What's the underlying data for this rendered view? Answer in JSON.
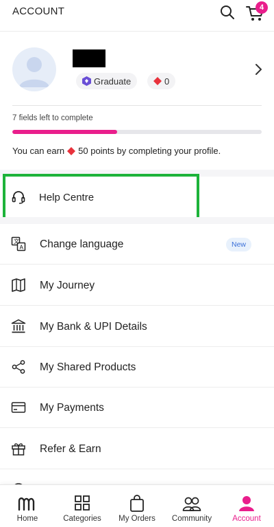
{
  "header": {
    "title": "ACCOUNT",
    "cart_count": "4"
  },
  "profile": {
    "badge_label": "Graduate",
    "points": "0",
    "fields_left": "7 fields left to complete",
    "progress_fraction": 0.42,
    "earn_prefix": "You can earn",
    "earn_suffix": "50 points by completing your profile."
  },
  "help": {
    "label": "Help Centre"
  },
  "menu": {
    "items": [
      {
        "label": "Change language",
        "icon": "translate-icon",
        "badge": "New"
      },
      {
        "label": "My Journey",
        "icon": "map-icon"
      },
      {
        "label": "My Bank & UPI Details",
        "icon": "bank-icon"
      },
      {
        "label": "My Shared Products",
        "icon": "share-icon"
      },
      {
        "label": "My Payments",
        "icon": "card-icon"
      },
      {
        "label": "Refer & Earn",
        "icon": "gift-icon"
      }
    ]
  },
  "bottom_nav": {
    "items": [
      {
        "label": "Home",
        "icon": "home-logo-icon"
      },
      {
        "label": "Categories",
        "icon": "grid-icon"
      },
      {
        "label": "My Orders",
        "icon": "bag-icon"
      },
      {
        "label": "Community",
        "icon": "people-icon"
      },
      {
        "label": "Account",
        "icon": "person-icon",
        "active": true
      }
    ]
  },
  "colors": {
    "accent": "#e91e8c",
    "highlight": "#1db33a",
    "gem": "#e8323c",
    "badge_purple": "#6a4fd6"
  }
}
